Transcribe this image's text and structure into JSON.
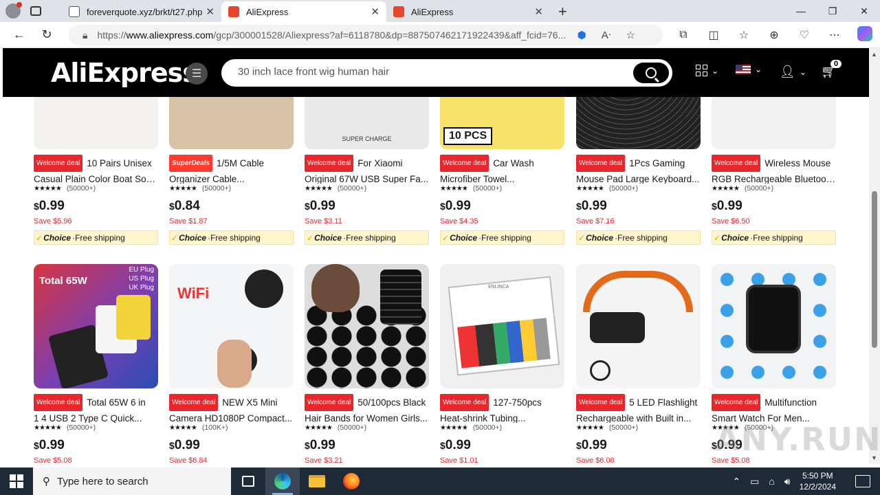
{
  "browser": {
    "tabs": [
      {
        "title": "foreverquote.xyz/brkt/t27.php"
      },
      {
        "title": "AliExpress"
      },
      {
        "title": "AliExpress"
      }
    ],
    "url_prefix": "https://",
    "url_host": "www.aliexpress.com",
    "url_rest": "/gcp/300001528/Aliexpress?af=6118780&dp=887507462171922439&aff_fcid=76..."
  },
  "site": {
    "logo": "AliExpress",
    "search_value": "30 inch lace front wig human hair",
    "cart_count": "0"
  },
  "products_row1": [
    {
      "badge": "Welcome deal",
      "title1": "10 Pairs Unisex",
      "title2": "Casual Plain Color Boat Soc...",
      "reviews": "(50000+)",
      "price_main": "0.99",
      "save": "Save $5.96",
      "choice": "Choice",
      "shipping": "Free shipping"
    },
    {
      "badge": "SuperDeals",
      "title1": "1/5M Cable",
      "title2": "Organizer Cable...",
      "reviews": "(50000+)",
      "price_main": "0.84",
      "save": "Save $1.87",
      "choice": "Choice",
      "shipping": "Free shipping"
    },
    {
      "badge": "Welcome deal",
      "title1": "For Xiaomi",
      "title2": "Original 67W USB Super Fa...",
      "reviews": "(50000+)",
      "price_main": "0.99",
      "save": "Save $3.11",
      "choice": "Choice",
      "shipping": "Free shipping"
    },
    {
      "badge": "Welcome deal",
      "title1": "Car Wash",
      "title2": "Microfiber Towel...",
      "reviews": "(50000+)",
      "price_main": "0.99",
      "save": "Save $4.35",
      "choice": "Choice",
      "shipping": "Free shipping"
    },
    {
      "badge": "Welcome deal",
      "title1": "1Pcs Gaming",
      "title2": "Mouse Pad Large Keyboard...",
      "reviews": "(50000+)",
      "price_main": "0.99",
      "save": "Save $7.16",
      "choice": "Choice",
      "shipping": "Free shipping"
    },
    {
      "badge": "Welcome deal",
      "title1": "Wireless Mouse",
      "title2": "RGB Rechargeable Bluetoot...",
      "reviews": "(50000+)",
      "price_main": "0.99",
      "save": "Save $6.50",
      "choice": "Choice",
      "shipping": "Free shipping"
    }
  ],
  "products_row2": [
    {
      "badge": "Welcome deal",
      "title1": "Total 65W 6 in",
      "title2": "1 4 USB 2 Type C Quick...",
      "reviews": "(50000+)",
      "price_main": "0.99",
      "save": "Save $5.08"
    },
    {
      "badge": "Welcome deal",
      "title1": "NEW X5 Mini",
      "title2": "Camera HD1080P Compact...",
      "reviews": "(100K+)",
      "price_main": "0.99",
      "save": "Save $6.84"
    },
    {
      "badge": "Welcome deal",
      "title1": "50/100pcs Black",
      "title2": "Hair Bands for Women Girls...",
      "reviews": "(50000+)",
      "price_main": "0.99",
      "save": "Save $3.21"
    },
    {
      "badge": "Welcome deal",
      "title1": "127-750pcs",
      "title2": "Heat-shrink Tubing...",
      "reviews": "(50000+)",
      "price_main": "0.99",
      "save": "Save $1.01"
    },
    {
      "badge": "Welcome deal",
      "title1": "5 LED Flashlight",
      "title2": "Rechargeable with Built in...",
      "reviews": "(50000+)",
      "price_main": "0.99",
      "save": "Save $6.08"
    },
    {
      "badge": "Welcome deal",
      "title1": "Multifunction",
      "title2": "Smart Watch For Men...",
      "reviews": "(50000+)",
      "price_main": "0.99",
      "save": "Save $5.08"
    }
  ],
  "image_text": {
    "p3": "SUPER CHARGE",
    "p4": "10 PCS",
    "p7": "Total 65W",
    "p7_plugs": "EU Plug US Plug UK Plug",
    "p8": "WiFi",
    "p10": "ENLINCA"
  },
  "currency": "$",
  "watermark": "ANY.RUN",
  "taskbar": {
    "search_placeholder": "Type here to search",
    "time": "5:50 PM",
    "date": "12/2/2024"
  },
  "colors": {
    "brand_red": "#e8262b",
    "header_bg": "#000000",
    "choice_bg": "#fff5cc"
  }
}
